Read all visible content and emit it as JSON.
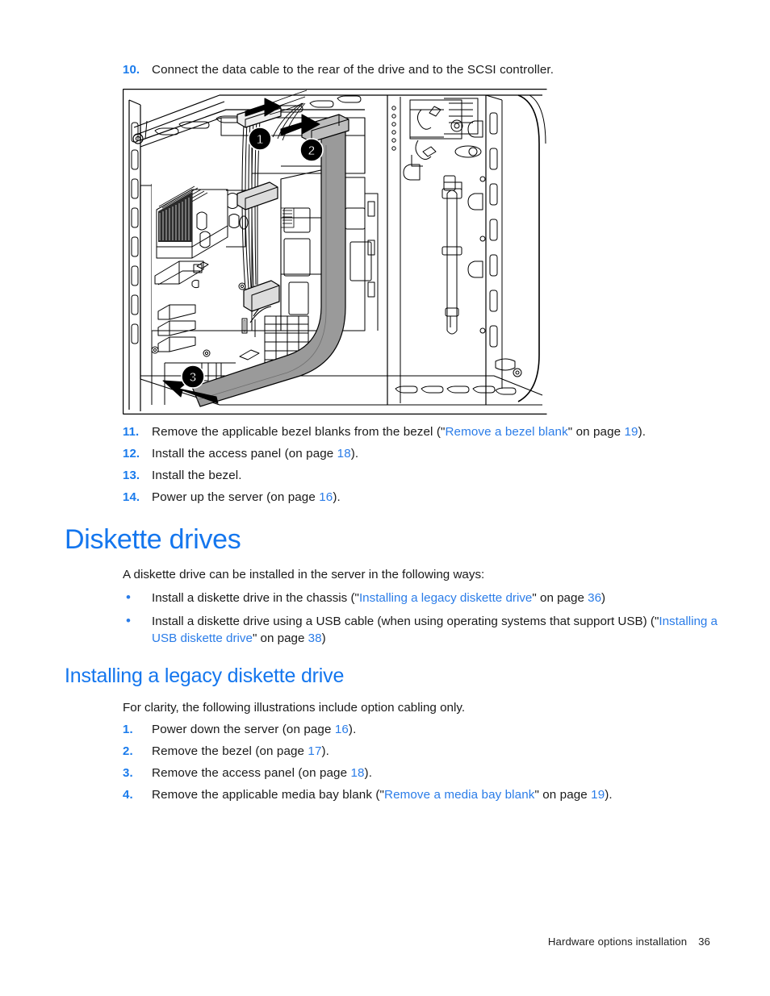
{
  "document": {
    "footer": {
      "chapter": "Hardware options installation",
      "page_number": "36"
    }
  },
  "steps_top": [
    {
      "number": "10.",
      "parts": [
        {
          "t": "Connect the data cable to the rear of the drive and to the SCSI controller.",
          "k": "plain"
        }
      ]
    }
  ],
  "figure": {
    "name": "scsi-data-cable-routing-illustration",
    "callouts": [
      {
        "label": "1",
        "meaning": "power-cable-connector"
      },
      {
        "label": "2",
        "meaning": "data-cable-to-scsi-controller"
      },
      {
        "label": "3",
        "meaning": "data-cable-to-drive-rear"
      }
    ]
  },
  "steps_after_figure": [
    {
      "number": "11.",
      "parts": [
        {
          "t": "Remove the applicable bezel blanks from the bezel (\"",
          "k": "plain"
        },
        {
          "t": "Remove a bezel blank",
          "k": "link"
        },
        {
          "t": "\" on page ",
          "k": "plain"
        },
        {
          "t": "19",
          "k": "page"
        },
        {
          "t": ").",
          "k": "plain"
        }
      ]
    },
    {
      "number": "12.",
      "parts": [
        {
          "t": "Install the access panel (on page ",
          "k": "plain"
        },
        {
          "t": "18",
          "k": "page"
        },
        {
          "t": ").",
          "k": "plain"
        }
      ]
    },
    {
      "number": "13.",
      "parts": [
        {
          "t": "Install the bezel.",
          "k": "plain"
        }
      ]
    },
    {
      "number": "14.",
      "parts": [
        {
          "t": "Power up the server (on page ",
          "k": "plain"
        },
        {
          "t": "16",
          "k": "page"
        },
        {
          "t": ").",
          "k": "plain"
        }
      ]
    }
  ],
  "section": {
    "title": "Diskette drives",
    "intro": "A diskette drive can be installed in the server in the following ways:",
    "bullets": [
      {
        "marker": "•",
        "parts": [
          {
            "t": "Install a diskette drive in the chassis (\"",
            "k": "plain"
          },
          {
            "t": "Installing a legacy diskette drive",
            "k": "link"
          },
          {
            "t": "\" on page ",
            "k": "plain"
          },
          {
            "t": "36",
            "k": "page"
          },
          {
            "t": ")",
            "k": "plain"
          }
        ]
      },
      {
        "marker": "•",
        "parts": [
          {
            "t": "Install a diskette drive using a USB cable (when using operating systems that support USB) (\"",
            "k": "plain"
          },
          {
            "t": "Installing a USB diskette drive",
            "k": "link"
          },
          {
            "t": "\" on page ",
            "k": "plain"
          },
          {
            "t": "38",
            "k": "page"
          },
          {
            "t": ")",
            "k": "plain"
          }
        ]
      }
    ]
  },
  "subsection": {
    "title": "Installing a legacy diskette drive",
    "intro": "For clarity, the following illustrations include option cabling only.",
    "steps": [
      {
        "number": "1.",
        "parts": [
          {
            "t": "Power down the server (on page ",
            "k": "plain"
          },
          {
            "t": "16",
            "k": "page"
          },
          {
            "t": ").",
            "k": "plain"
          }
        ]
      },
      {
        "number": "2.",
        "parts": [
          {
            "t": "Remove the bezel (on page ",
            "k": "plain"
          },
          {
            "t": "17",
            "k": "page"
          },
          {
            "t": ").",
            "k": "plain"
          }
        ]
      },
      {
        "number": "3.",
        "parts": [
          {
            "t": "Remove the access panel (on page ",
            "k": "plain"
          },
          {
            "t": "18",
            "k": "page"
          },
          {
            "t": ").",
            "k": "plain"
          }
        ]
      },
      {
        "number": "4.",
        "parts": [
          {
            "t": "Remove the applicable media bay blank (\"",
            "k": "plain"
          },
          {
            "t": "Remove a media bay blank",
            "k": "link"
          },
          {
            "t": "\" on page ",
            "k": "plain"
          },
          {
            "t": "19",
            "k": "page"
          },
          {
            "t": ").",
            "k": "plain"
          }
        ]
      }
    ]
  },
  "colors": {
    "heading_blue": "#1476EE",
    "link_blue": "#2A7CE8",
    "body_black": "#1a1a1a"
  }
}
